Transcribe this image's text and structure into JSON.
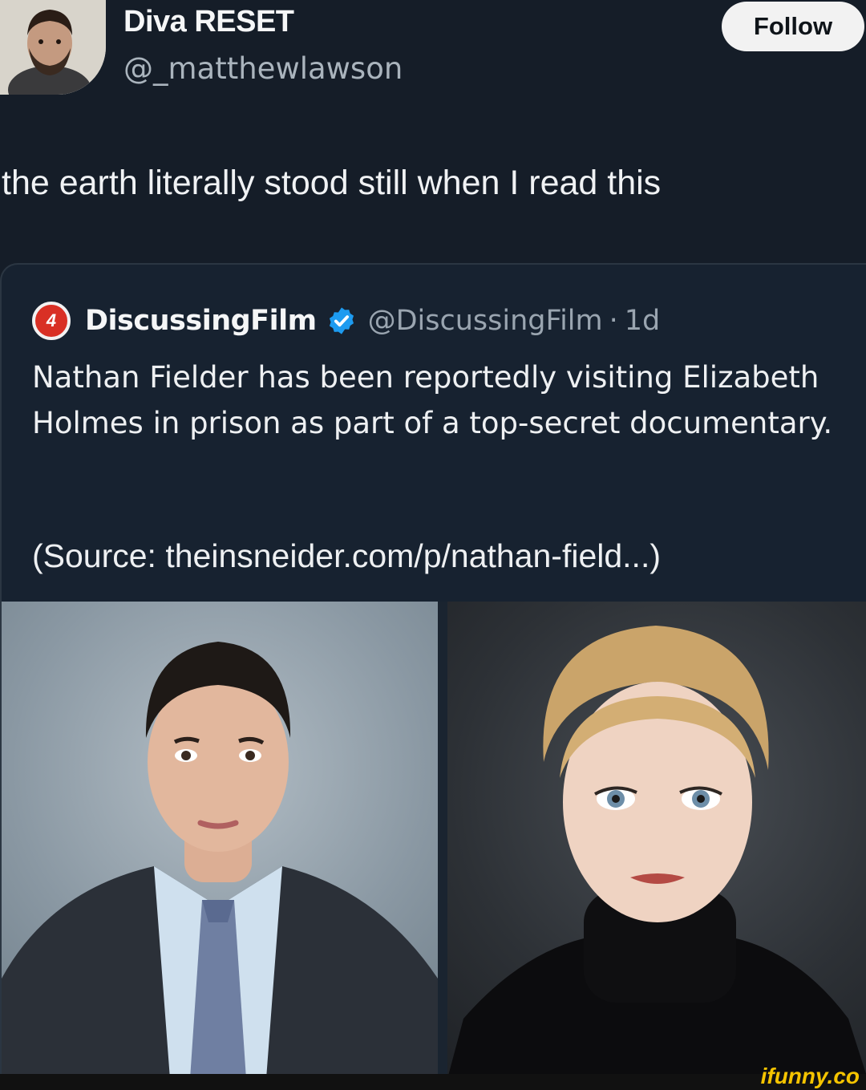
{
  "tweet": {
    "author": {
      "display_name": "Diva RESET",
      "handle": "@_matthewlawson"
    },
    "follow_label": "Follow",
    "text": "the earth literally stood still when I read this"
  },
  "quote": {
    "logo_text": "4",
    "name": "DiscussingFilm",
    "verified": true,
    "handle": "@DiscussingFilm",
    "separator": "·",
    "time": "1d",
    "body": "Nathan Fielder has been reportedly visiting Elizabeth Holmes in prison as part of a top-secret documentary.",
    "source": "(Source: theinsneider.com/p/nathan-field...)",
    "images": [
      "photo-man-in-suit",
      "photo-woman-in-black-turtleneck"
    ]
  },
  "watermark": "ifunny.co",
  "colors": {
    "background": "#151d28",
    "quote_background": "#172230",
    "accent_verified": "#1d9bf0",
    "logo_red": "#d93025",
    "watermark": "#f5c400"
  }
}
